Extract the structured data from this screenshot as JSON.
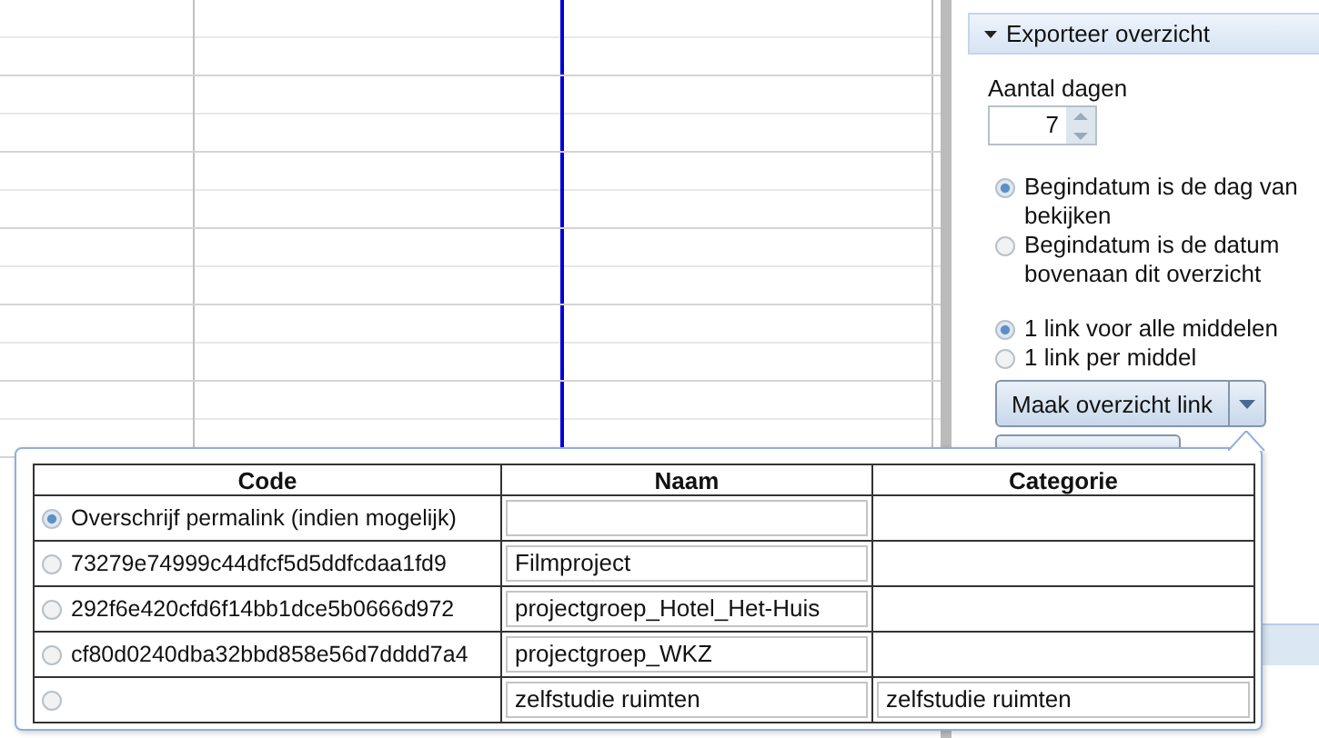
{
  "panel": {
    "title": "Exporteer overzicht",
    "days_label": "Aantal dagen",
    "days_value": "7",
    "start_options": [
      {
        "label": "Begindatum is de dag van bekijken",
        "selected": true
      },
      {
        "label": "Begindatum is de datum bovenaan dit overzicht",
        "selected": false
      }
    ],
    "link_options": [
      {
        "label": "1 link voor alle middelen",
        "selected": true
      },
      {
        "label": "1 link per middel",
        "selected": false
      }
    ],
    "button": "Maak overzicht link"
  },
  "popup": {
    "columns": [
      "Code",
      "Naam",
      "Categorie"
    ],
    "rows": [
      {
        "code": "Overschrijf permalink (indien mogelijk)",
        "selected": true
      },
      {
        "code": "73279e74999c44dfcf5d5ddfcdaa1fd9",
        "naam": "Filmproject",
        "selected": false
      },
      {
        "code": "292f6e420cfd6f14bb1dce5b0666d972",
        "naam": "projectgroep_Hotel_Het-Huis",
        "selected": false
      },
      {
        "code": "cf80d0240dba32bbd858e56d7dddd7a4",
        "naam": "projectgroep_WKZ",
        "selected": false
      },
      {
        "naam": "zelfstudie ruimten",
        "categorie": "zelfstudie ruimten",
        "selected": false
      }
    ]
  }
}
